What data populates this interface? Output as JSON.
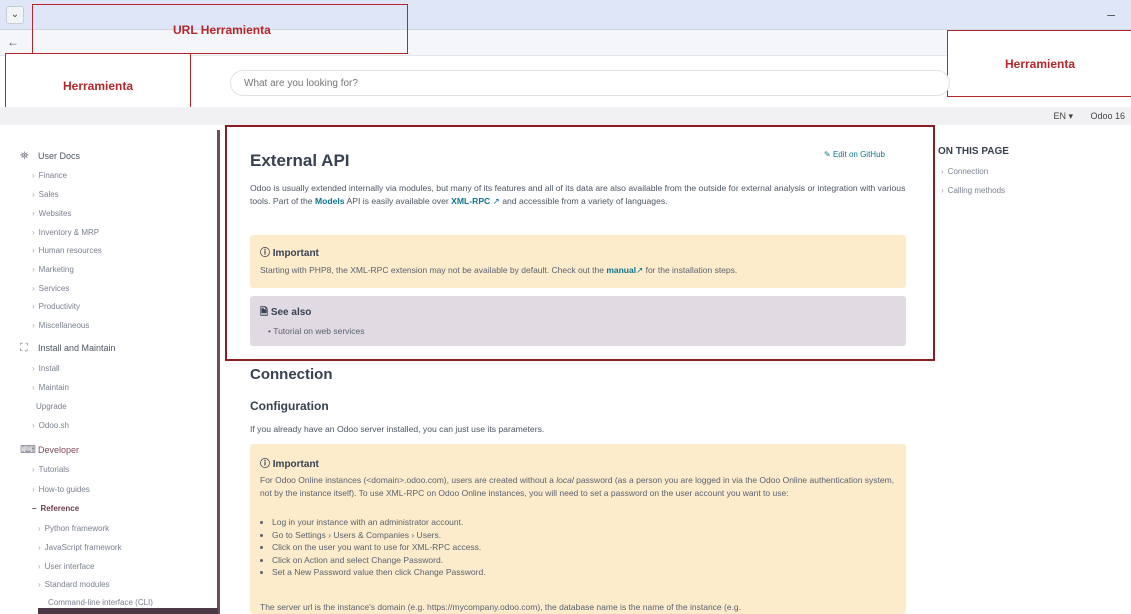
{
  "browser": {
    "tab_chevron": "⌄",
    "back": "←",
    "minimize": "–"
  },
  "annotations": {
    "url": "URL Herramienta",
    "tool_left": "Herramienta",
    "tool_right": "Herramienta"
  },
  "search": {
    "placeholder": "What are you looking for?"
  },
  "topbar": {
    "lang": "EN ▾",
    "version": "Odoo 16"
  },
  "sidebar": {
    "user_docs": "User Docs",
    "user_items": [
      "Finance",
      "Sales",
      "Websites",
      "Inventory & MRP",
      "Human resources",
      "Marketing",
      "Services",
      "Productivity",
      "Miscellaneous"
    ],
    "install": "Install and Maintain",
    "install_items": [
      "Install",
      "Maintain",
      "Upgrade",
      "Odoo.sh"
    ],
    "developer": "Developer",
    "dev_items": [
      "Tutorials",
      "How-to guides",
      "Reference"
    ],
    "ref_items": [
      "Python framework",
      "JavaScript framework",
      "User interface",
      "Standard modules",
      "Command-line interface (CLI)"
    ]
  },
  "main": {
    "title": "External API",
    "edit_github": "Edit on GitHub",
    "intro_1": "Odoo is usually extended internally via modules, but many of its features and all of its data are also available from the outside for external analysis or integration with various tools. Part of the ",
    "intro_models": "Models",
    "intro_2": " API is easily available over ",
    "intro_xmlrpc": "XML-RPC",
    "intro_3": " and accessible from a variety of languages.",
    "important_title": "Important",
    "important_text_1": "Starting with PHP8, the XML-RPC extension may not be available by default. Check out the ",
    "important_manual": "manual",
    "important_text_2": " for the installation steps.",
    "see_also_title": "See also",
    "see_also_item": "Tutorial on web services",
    "connection": "Connection",
    "configuration": "Configuration",
    "config_text": "If you already have an Odoo server installed, you can just use its parameters.",
    "important2_title": "Important",
    "important2_para_1": "For Odoo Online instances (<domain>.odoo.com), users are created without a ",
    "important2_local": "local",
    "important2_para_2": " password (as a person you are logged in via the Odoo Online authentication system, not by the instance itself). To use XML-RPC on Odoo Online instances, you will need to set a password on the user account you want to use:",
    "steps": [
      "Log in your instance with an administrator account.",
      "Go to Settings › Users & Companies › Users.",
      "Click on the user you want to use for XML-RPC access.",
      "Click on Action and select Change Password.",
      "Set a New Password value then click Change Password."
    ],
    "tail": "The server url is the instance's domain (e.g. https://mycompany.odoo.com), the database name is the name of the instance (e.g."
  },
  "toc": {
    "title": "ON THIS PAGE",
    "items": [
      "Connection",
      "Calling methods"
    ]
  }
}
